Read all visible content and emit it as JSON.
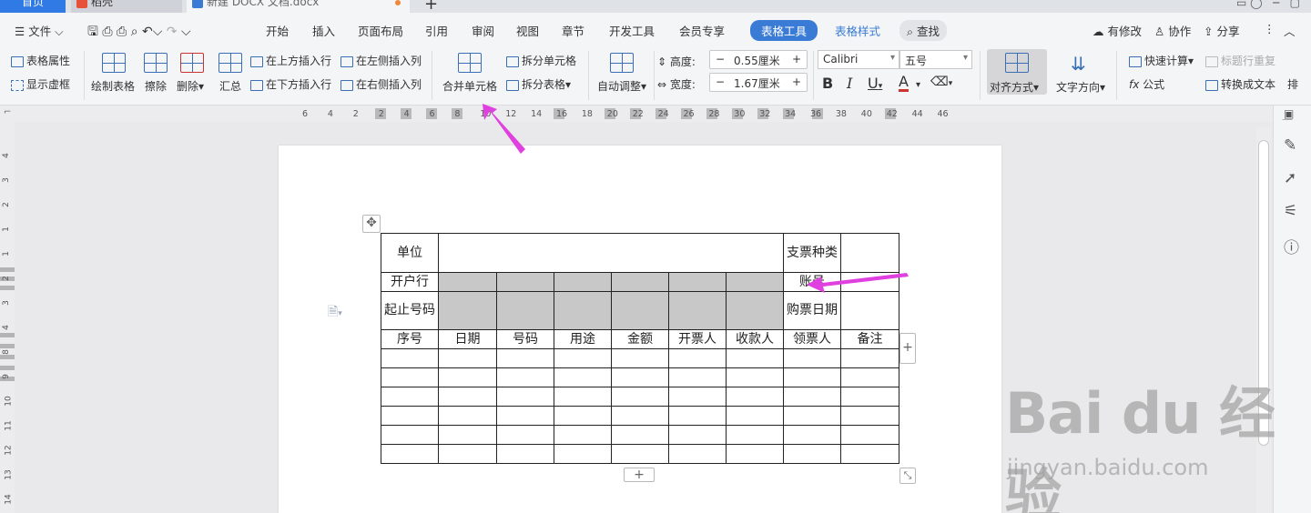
{
  "titlebar": {
    "home_tab": "首页",
    "tab2": "稻壳",
    "tab3": "新建 DOCX 文档.docx"
  },
  "menu": {
    "file": "文件",
    "items": [
      "开始",
      "插入",
      "页面布局",
      "引用",
      "审阅",
      "视图",
      "章节",
      "开发工具",
      "会员专享"
    ],
    "active": "表格工具",
    "table_style": "表格样式",
    "search": "查找",
    "has_changes": "有修改",
    "collab": "协作",
    "share": "分享"
  },
  "ribbon": {
    "table_props": "表格属性",
    "show_gridlines": "显示虚框",
    "draw_table": "绘制表格",
    "erase": "擦除",
    "delete": "删除",
    "summary": "汇总",
    "insert_row_above": "在上方插入行",
    "insert_row_below": "在下方插入行",
    "insert_col_left": "在左侧插入列",
    "insert_col_right": "在右侧插入列",
    "merge_cells": "合并单元格",
    "split_cells": "拆分单元格",
    "split_table": "拆分表格",
    "auto_fit": "自动调整",
    "height_label": "高度:",
    "height_value": "0.55厘米",
    "width_label": "宽度:",
    "width_value": "1.67厘米",
    "font_name": "Calibri",
    "font_size": "五号",
    "align": "对齐方式",
    "text_dir": "文字方向",
    "quick_calc": "快速计算",
    "repeat_header": "标题行重复",
    "formula": "公式",
    "to_text": "转换成文本",
    "more": "排"
  },
  "ruler_ticks": [
    "6",
    "4",
    "2",
    "2",
    "4",
    "6",
    "8",
    "10",
    "12",
    "14",
    "16",
    "18",
    "20",
    "22",
    "24",
    "26",
    "28",
    "30",
    "32",
    "34",
    "36",
    "38",
    "40",
    "42",
    "44",
    "46"
  ],
  "vruler_ticks": [
    "4",
    "3",
    "2",
    "1",
    "1",
    "2",
    "3",
    "4",
    "8",
    "9",
    "10",
    "11",
    "12",
    "13",
    "14"
  ],
  "table": {
    "row1": {
      "c1": "单位",
      "c8": "支票种类"
    },
    "row2": {
      "c1": "开户行",
      "c8": "账号"
    },
    "row3": {
      "c1": "起止号码",
      "c8": "购票日期"
    },
    "headers": [
      "序号",
      "日期",
      "号码",
      "用途",
      "金额",
      "开票人",
      "收款人",
      "领票人",
      "备注"
    ]
  },
  "watermark": {
    "logo": "Bai du 经验",
    "url": "jingyan.baidu.com"
  },
  "colors": {
    "accent": "#3a7bd5",
    "arrow": "#e040e0",
    "gray_cell": "#c8c8c8"
  }
}
